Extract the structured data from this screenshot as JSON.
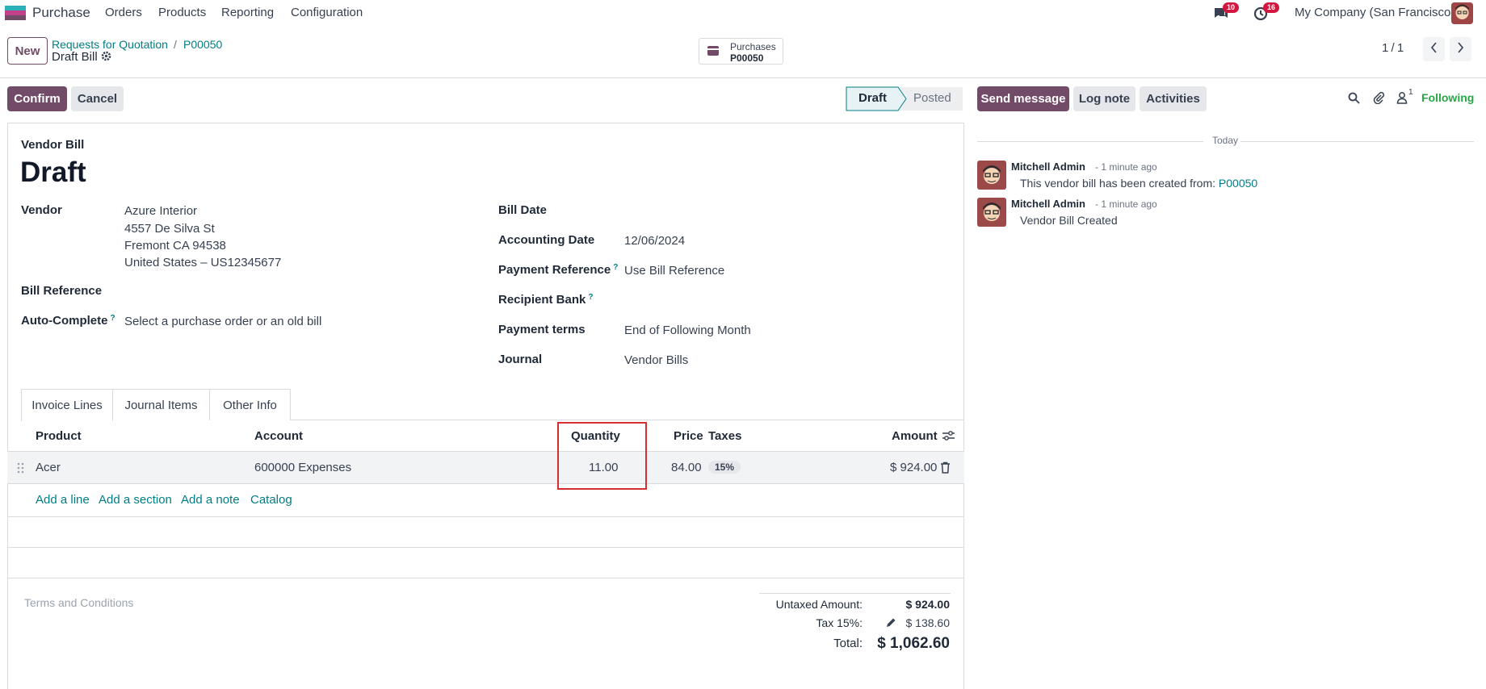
{
  "nav": {
    "app_name": "Purchase",
    "menu": [
      "Orders",
      "Products",
      "Reporting",
      "Configuration"
    ],
    "messages_count": "10",
    "activities_count": "16",
    "company": "My Company (San Francisco)"
  },
  "control": {
    "new_label": "New",
    "breadcrumb_parent": "Requests for Quotation",
    "breadcrumb_sep": "/",
    "breadcrumb_current": "P00050",
    "record_title": "Draft Bill",
    "smart_button_title": "Purchases",
    "smart_button_value": "P00050",
    "pager": "1 / 1"
  },
  "actions": {
    "confirm": "Confirm",
    "cancel": "Cancel",
    "status_draft": "Draft",
    "status_posted": "Posted"
  },
  "form": {
    "doc_type": "Vendor Bill",
    "state_title": "Draft",
    "vendor_label": "Vendor",
    "vendor_name": "Azure Interior",
    "vendor_addr1": "4557 De Silva St",
    "vendor_addr2": "Fremont CA 94538",
    "vendor_addr3": "United States – US12345677",
    "bill_reference_label": "Bill Reference",
    "auto_complete_label": "Auto-Complete",
    "auto_complete_placeholder": "Select a purchase order or an old bill",
    "bill_date_label": "Bill Date",
    "accounting_date_label": "Accounting Date",
    "accounting_date": "12/06/2024",
    "payment_reference_label": "Payment Reference",
    "payment_reference_placeholder": "Use Bill Reference",
    "recipient_bank_label": "Recipient Bank",
    "payment_terms_label": "Payment terms",
    "payment_terms": "End of Following Month",
    "journal_label": "Journal",
    "journal": "Vendor Bills",
    "question_mark": "?"
  },
  "tabs": [
    "Invoice Lines",
    "Journal Items",
    "Other Info"
  ],
  "lines": {
    "headers": {
      "product": "Product",
      "account": "Account",
      "quantity": "Quantity",
      "price": "Price",
      "taxes": "Taxes",
      "amount": "Amount"
    },
    "row": {
      "product": "Acer",
      "account": "600000 Expenses",
      "quantity": "11.00",
      "price": "84.00",
      "tax": "15%",
      "amount": "$ 924.00"
    },
    "add_links": [
      "Add a line",
      "Add a section",
      "Add a note",
      "Catalog"
    ]
  },
  "footer": {
    "terms_placeholder": "Terms and Conditions",
    "untaxed_label": "Untaxed Amount:",
    "untaxed_value": "$ 924.00",
    "tax_label": "Tax 15%:",
    "tax_value": "$ 138.60",
    "total_label": "Total:",
    "total_value": "$ 1,062.60"
  },
  "chatter": {
    "send_message": "Send message",
    "log_note": "Log note",
    "activities": "Activities",
    "followers_count": "1",
    "following": "Following",
    "day_separator": "Today",
    "messages": [
      {
        "author": "Mitchell Admin",
        "time": "- 1 minute ago",
        "body": "This vendor bill has been created from: ",
        "link": "P00050"
      },
      {
        "author": "Mitchell Admin",
        "time": "- 1 minute ago",
        "body": "Vendor Bill Created",
        "link": ""
      }
    ]
  },
  "colors": {
    "brand": "#714b67",
    "link": "#017e84",
    "highlight_box": "#d32f2f",
    "following": "#28a745"
  }
}
